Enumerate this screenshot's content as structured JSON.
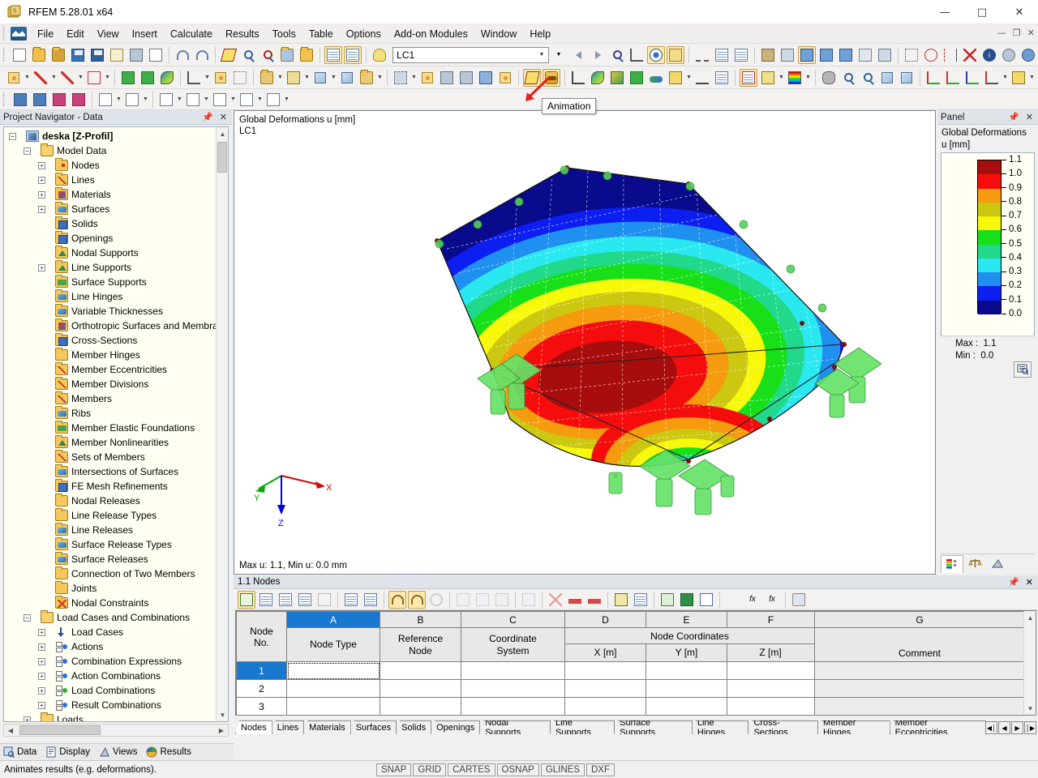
{
  "window": {
    "title": "RFEM 5.28.01 x64",
    "app_icon": "rfem-logo-icon",
    "controls": {
      "minimize": "—",
      "maximize": "□",
      "close": "✕"
    },
    "mdi_controls": {
      "minimize": "—",
      "restore": "❐",
      "close": "✕"
    }
  },
  "menu": {
    "logo": "rfem-menu-logo-icon",
    "items": [
      {
        "label": "File",
        "accel": "F"
      },
      {
        "label": "Edit",
        "accel": "E"
      },
      {
        "label": "View",
        "accel": "V"
      },
      {
        "label": "Insert",
        "accel": "I"
      },
      {
        "label": "Calculate",
        "accel": "C"
      },
      {
        "label": "Results",
        "accel": "R"
      },
      {
        "label": "Tools",
        "accel": "T"
      },
      {
        "label": "Table",
        "accel": "b"
      },
      {
        "label": "Options",
        "accel": "O"
      },
      {
        "label": "Add-on Modules",
        "accel": "d"
      },
      {
        "label": "Window",
        "accel": "W"
      },
      {
        "label": "Help",
        "accel": "H"
      }
    ]
  },
  "toolbar_main": {
    "load_case_value": "LC1",
    "load_case_placeholder": "LC1",
    "buttons": [
      "new-document-icon",
      "open-folder-icon",
      "open-recent-icon",
      "save-as-icon",
      "save-icon",
      "clipboard-icon",
      "print-preview-icon",
      "print-icon",
      "undo-icon",
      "redo-icon",
      "render-model-icon",
      "zoom-icon",
      "zoom-detail-icon",
      "insert-object-icon",
      "copy-window-icon",
      "table-view-icon",
      "table-grid-icon",
      "lightbulb-icon"
    ],
    "nav_buttons": [
      "previous-arrow-icon",
      "next-arrow-icon",
      "select-object-icon",
      "dimension-icon",
      "show-results-icon",
      "result-values-icon",
      "deform-icon",
      "printout-report-icon",
      "printout-icon",
      "fe-mesh-icon",
      "fe-mesh-settings-icon",
      "surface-result-icon",
      "surface-result-2-icon",
      "surface-result-3-icon",
      "grid-results-icon",
      "render-result-icon",
      "measure-icon",
      "rotate-icon",
      "mirror-icon",
      "delete-cross-icon",
      "info-icon",
      "clock-icon",
      "globe-icon"
    ]
  },
  "toolbar_second": {
    "buttons": [
      "new-node-icon",
      "new-line-icon",
      "new-member-icon",
      "new-polygon-icon",
      "new-nodal-support-icon",
      "new-line-support-icon",
      "new-surface-icon",
      "new-line-hinge-icon",
      "new-eccentricity-icon",
      "select-region-icon",
      "new-surface-load-icon",
      "new-opening-icon",
      "new-solid-icon",
      "new-block-icon",
      "new-copy-icon",
      "move-icon",
      "scale-icon",
      "mirror-objects-icon",
      "rotate-objects-icon",
      "project-objects-icon",
      "extrude-icon",
      "animation-graph-icon",
      "animation-icon",
      "axis-icon",
      "color-surface-icon",
      "cube-results-icon",
      "iso-surface-icon",
      "section-icon",
      "tiles-icon",
      "section-cut-icon",
      "result-table-icon",
      "printout-report-2-icon",
      "magic-wand-icon",
      "color-scale-icon",
      "mouse-icon",
      "zoom-window-icon",
      "zoom-out-icon",
      "cube-view-icon",
      "perspective-icon",
      "view-x-icon",
      "view-y-icon",
      "view-z-icon",
      "view-minus-x-icon",
      "render-mode-icon",
      "visibility-icon"
    ],
    "active_buttons": [
      "animation-graph-icon",
      "animation-icon"
    ]
  },
  "toolbar_third": {
    "buttons": [
      "support-down-icon",
      "support-up-icon",
      "load-down-icon",
      "load-up-icon",
      "coord-abs-icon",
      "coord-rel-icon",
      "dim-1-icon",
      "dim-2-icon",
      "dim-3-icon",
      "dim-4-icon",
      "dim-5-icon"
    ]
  },
  "tooltip": {
    "text": "Animation",
    "arrow": "red-arrow-pointer"
  },
  "navigator": {
    "title": "Project Navigator - Data",
    "pin_icon": "pin-icon",
    "close_icon": "close-icon",
    "tree": [
      {
        "label": "deska [Z-Profil]",
        "depth": 0,
        "toggle": "minus",
        "icon": "model-icon",
        "bold": true
      },
      {
        "label": "Model Data",
        "depth": 1,
        "toggle": "minus",
        "icon": "folder-open-icon",
        "bold": false
      },
      {
        "label": "Nodes",
        "depth": 2,
        "toggle": "plus",
        "icon": "folder-nodes-icon",
        "bold": false
      },
      {
        "label": "Lines",
        "depth": 2,
        "toggle": "plus",
        "icon": "folder-lines-icon",
        "bold": false
      },
      {
        "label": "Materials",
        "depth": 2,
        "toggle": "plus",
        "icon": "folder-materials-icon",
        "bold": false
      },
      {
        "label": "Surfaces",
        "depth": 2,
        "toggle": "plus",
        "icon": "folder-surfaces-icon",
        "bold": false
      },
      {
        "label": "Solids",
        "depth": 2,
        "toggle": "none",
        "icon": "folder-solids-icon",
        "bold": false
      },
      {
        "label": "Openings",
        "depth": 2,
        "toggle": "none",
        "icon": "folder-openings-icon",
        "bold": false
      },
      {
        "label": "Nodal Supports",
        "depth": 2,
        "toggle": "none",
        "icon": "folder-supports-icon",
        "bold": false
      },
      {
        "label": "Line Supports",
        "depth": 2,
        "toggle": "plus",
        "icon": "folder-supports-icon",
        "bold": false
      },
      {
        "label": "Surface Supports",
        "depth": 2,
        "toggle": "none",
        "icon": "folder-surf-sup-icon",
        "bold": false
      },
      {
        "label": "Line Hinges",
        "depth": 2,
        "toggle": "none",
        "icon": "folder-hinges-icon",
        "bold": false
      },
      {
        "label": "Variable Thicknesses",
        "depth": 2,
        "toggle": "none",
        "icon": "folder-thickness-icon",
        "bold": false
      },
      {
        "label": "Orthotropic Surfaces and Membra",
        "depth": 2,
        "toggle": "none",
        "icon": "folder-ortho-icon",
        "bold": false
      },
      {
        "label": "Cross-Sections",
        "depth": 2,
        "toggle": "none",
        "icon": "folder-cross-sec-icon",
        "bold": false
      },
      {
        "label": "Member Hinges",
        "depth": 2,
        "toggle": "none",
        "icon": "folder-icon",
        "bold": false
      },
      {
        "label": "Member Eccentricities",
        "depth": 2,
        "toggle": "none",
        "icon": "folder-ecc-icon",
        "bold": false
      },
      {
        "label": "Member Divisions",
        "depth": 2,
        "toggle": "none",
        "icon": "folder-div-icon",
        "bold": false
      },
      {
        "label": "Members",
        "depth": 2,
        "toggle": "none",
        "icon": "folder-members-icon",
        "bold": false
      },
      {
        "label": "Ribs",
        "depth": 2,
        "toggle": "none",
        "icon": "folder-ribs-icon",
        "bold": false
      },
      {
        "label": "Member Elastic Foundations",
        "depth": 2,
        "toggle": "none",
        "icon": "folder-found-icon",
        "bold": false
      },
      {
        "label": "Member Nonlinearities",
        "depth": 2,
        "toggle": "none",
        "icon": "folder-nonlin-icon",
        "bold": false
      },
      {
        "label": "Sets of Members",
        "depth": 2,
        "toggle": "none",
        "icon": "folder-sets-icon",
        "bold": false
      },
      {
        "label": "Intersections of Surfaces",
        "depth": 2,
        "toggle": "none",
        "icon": "folder-inters-icon",
        "bold": false
      },
      {
        "label": "FE Mesh Refinements",
        "depth": 2,
        "toggle": "none",
        "icon": "folder-femesh-icon",
        "bold": false
      },
      {
        "label": "Nodal Releases",
        "depth": 2,
        "toggle": "none",
        "icon": "folder-icon",
        "bold": false
      },
      {
        "label": "Line Release Types",
        "depth": 2,
        "toggle": "none",
        "icon": "folder-icon",
        "bold": false
      },
      {
        "label": "Line Releases",
        "depth": 2,
        "toggle": "none",
        "icon": "folder-rel-icon",
        "bold": false
      },
      {
        "label": "Surface Release Types",
        "depth": 2,
        "toggle": "none",
        "icon": "folder-srel-icon",
        "bold": false
      },
      {
        "label": "Surface Releases",
        "depth": 2,
        "toggle": "none",
        "icon": "folder-srel-icon",
        "bold": false
      },
      {
        "label": "Connection of Two Members",
        "depth": 2,
        "toggle": "none",
        "icon": "folder-icon",
        "bold": false
      },
      {
        "label": "Joints",
        "depth": 2,
        "toggle": "none",
        "icon": "folder-icon",
        "bold": false
      },
      {
        "label": "Nodal Constraints",
        "depth": 2,
        "toggle": "none",
        "icon": "folder-constr-icon",
        "bold": false
      },
      {
        "label": "Load Cases and Combinations",
        "depth": 1,
        "toggle": "minus",
        "icon": "folder-open-icon",
        "bold": false
      },
      {
        "label": "Load Cases",
        "depth": 2,
        "toggle": "plus",
        "icon": "load-arrow-icon",
        "bold": false
      },
      {
        "label": "Actions",
        "depth": 2,
        "toggle": "plus",
        "icon": "combination-icon",
        "bold": false
      },
      {
        "label": "Combination Expressions",
        "depth": 2,
        "toggle": "plus",
        "icon": "combination-icon",
        "bold": false
      },
      {
        "label": "Action Combinations",
        "depth": 2,
        "toggle": "plus",
        "icon": "combination-icon",
        "bold": false
      },
      {
        "label": "Load Combinations",
        "depth": 2,
        "toggle": "plus",
        "icon": "combination-green-icon",
        "bold": false
      },
      {
        "label": "Result Combinations",
        "depth": 2,
        "toggle": "plus",
        "icon": "combination-icon",
        "bold": false
      },
      {
        "label": "Loads",
        "depth": 1,
        "toggle": "plus",
        "icon": "folder-open-icon",
        "bold": false
      }
    ]
  },
  "view": {
    "label_line1": "Global Deformations u [mm]",
    "label_line2": "LC1",
    "footer": "Max u: 1.1, Min u: 0.0 mm",
    "axes": {
      "x": "X",
      "y": "Y",
      "z": "Z",
      "x_color": "#dd0000",
      "y_color": "#00aa00",
      "z_color": "#0000dd"
    }
  },
  "panel": {
    "title": "Panel",
    "pin_icon": "pin-icon",
    "close_icon": "close-icon",
    "heading_line1": "Global Deformations",
    "heading_line2": "u [mm]",
    "max_label": "Max :",
    "max_value": "1.1",
    "min_label": "Min :",
    "min_value": "0.0",
    "zoom_icon": "legend-zoom-icon",
    "tabs": [
      "color-legend-tab-icon",
      "scales-tab-icon",
      "views-tab-icon"
    ],
    "active_tab": 0
  },
  "chart_data": {
    "type": "heatmap",
    "title": "Global Deformations u [mm]",
    "subtitle": "LC1",
    "unit": "mm",
    "quantity": "u",
    "load_case": "LC1",
    "max": 1.1,
    "min": 0.0,
    "legend_position": "right",
    "tick_labels": [
      "1.1",
      "1.0",
      "0.9",
      "0.8",
      "0.7",
      "0.6",
      "0.5",
      "0.4",
      "0.3",
      "0.2",
      "0.1",
      "0.0"
    ],
    "tick_values": [
      1.1,
      1.0,
      0.9,
      0.8,
      0.7,
      0.6,
      0.5,
      0.4,
      0.3,
      0.2,
      0.1,
      0.0
    ],
    "band_colors": [
      "#a80d0d",
      "#f50d0d",
      "#f59b0d",
      "#ccc711",
      "#f8f80a",
      "#17e018",
      "#21d98a",
      "#2ae8f0",
      "#1f8ff0",
      "#0d1ff0",
      "#090a8c"
    ],
    "band_ranges": [
      [
        1.0,
        1.1
      ],
      [
        0.9,
        1.0
      ],
      [
        0.8,
        0.9
      ],
      [
        0.7,
        0.8
      ],
      [
        0.6,
        0.7
      ],
      [
        0.5,
        0.6
      ],
      [
        0.4,
        0.5
      ],
      [
        0.3,
        0.4
      ],
      [
        0.2,
        0.3
      ],
      [
        0.1,
        0.2
      ],
      [
        0.0,
        0.1
      ]
    ]
  },
  "table": {
    "title": "1.1 Nodes",
    "pin_icon": "pin-icon",
    "close_icon": "close-icon",
    "toolbar_buttons": [
      "edit-table-icon",
      "insert-row-icon",
      "delete-row-icon",
      "table-settings-icon",
      "validate-icon",
      "align-left-icon",
      "align-right-icon",
      "undo-table-icon",
      "redo-table-icon",
      "refresh-icon",
      "add-obj-icon",
      "remove-obj-icon",
      "info-table-icon",
      "clear-table-icon",
      "delete-red-icon",
      "cut-left-icon",
      "cut-right-icon",
      "color-table-icon",
      "grid-table-icon",
      "export-table-icon",
      "excel-icon",
      "chart-table-icon",
      "formula-icon",
      "fx-icon",
      "fx2-icon",
      "lock-icon"
    ],
    "column_letters": [
      "A",
      "B",
      "C",
      "D",
      "E",
      "F",
      "G"
    ],
    "selected_column": "A",
    "row_header_l1": "Node",
    "row_header_l2": "No.",
    "group_header": "Node Coordinates",
    "group_span": [
      "D",
      "E",
      "F"
    ],
    "headers": [
      {
        "l1": "",
        "l2": "Node Type"
      },
      {
        "l1": "Reference",
        "l2": "Node"
      },
      {
        "l1": "Coordinate",
        "l2": "System"
      },
      {
        "l1": "",
        "l2": "X [m]"
      },
      {
        "l1": "",
        "l2": "Y [m]"
      },
      {
        "l1": "",
        "l2": "Z [m]"
      },
      {
        "l1": "",
        "l2": "Comment"
      }
    ],
    "rows": [
      {
        "no": "1",
        "cells": [
          "",
          "",
          "",
          "",
          "",
          "",
          ""
        ],
        "selected": true
      },
      {
        "no": "2",
        "cells": [
          "",
          "",
          "",
          "",
          "",
          "",
          ""
        ],
        "selected": false
      },
      {
        "no": "3",
        "cells": [
          "",
          "",
          "",
          "",
          "",
          "",
          ""
        ],
        "selected": false
      }
    ],
    "tabs": [
      "Nodes",
      "Lines",
      "Materials",
      "Surfaces",
      "Solids",
      "Openings",
      "Nodal Supports",
      "Line Supports",
      "Surface Supports",
      "Line Hinges",
      "Cross-Sections",
      "Member Hinges",
      "Member Eccentricities"
    ],
    "active_tab": "Nodes",
    "tab_nav": [
      "◀│",
      "◀",
      "▶",
      "│▶"
    ]
  },
  "bottom_tabs": [
    {
      "label": "Data",
      "icon": "data-tab-icon",
      "active": true
    },
    {
      "label": "Display",
      "icon": "display-tab-icon",
      "active": false
    },
    {
      "label": "Views",
      "icon": "views-tab-icon",
      "active": false
    },
    {
      "label": "Results",
      "icon": "results-tab-icon",
      "active": false
    }
  ],
  "status": {
    "message": "Animates results (e.g. deformations).",
    "toggles": [
      "SNAP",
      "GRID",
      "CARTES",
      "OSNAP",
      "GLINES",
      "DXF"
    ]
  }
}
